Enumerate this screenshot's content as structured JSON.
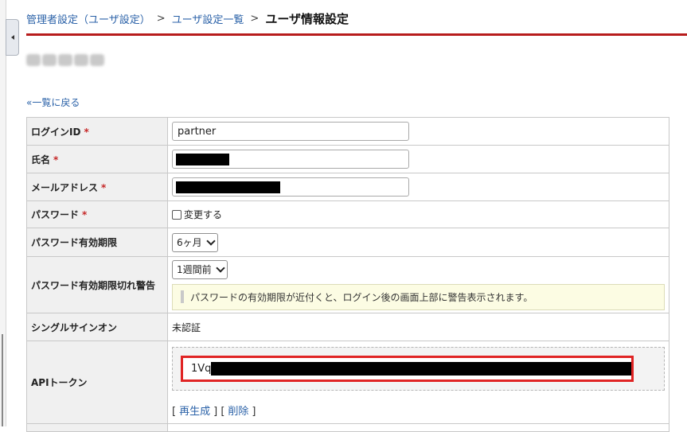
{
  "breadcrumb": {
    "item1": "管理者設定（ユーザ設定）",
    "sep": ">",
    "item2": "ユーザ設定一覧",
    "current": "ユーザ情報設定"
  },
  "back_link": "«一覧に戻る",
  "form": {
    "login_id": {
      "label": "ログインID",
      "required_mark": "*",
      "value": "partner"
    },
    "full_name": {
      "label": "氏名",
      "required_mark": "*"
    },
    "email": {
      "label": "メールアドレス",
      "required_mark": "*"
    },
    "password": {
      "label": "パスワード",
      "required_mark": "*",
      "checkbox_label": "変更する",
      "checked": false
    },
    "password_expiry": {
      "label": "パスワード有効期限",
      "selected": "6ヶ月"
    },
    "password_warning": {
      "label": "パスワード有効期限切れ警告",
      "selected": "1週間前",
      "hint": "パスワードの有効期限が近付くと、ログイン後の画面上部に警告表示されます。"
    },
    "sso": {
      "label": "シングルサインオン",
      "value": "未認証"
    },
    "api_token": {
      "label": "APIトークン",
      "visible_prefix": "1Vq",
      "bracket_open": "[",
      "bracket_close": "]",
      "regenerate": "再生成",
      "delete": "削除"
    }
  },
  "colors": {
    "accent_red": "#b71c1c",
    "highlight_red": "#e02424",
    "link_blue": "#2b62a8",
    "required_red": "#c62828",
    "hint_bg": "#fcfce3"
  }
}
